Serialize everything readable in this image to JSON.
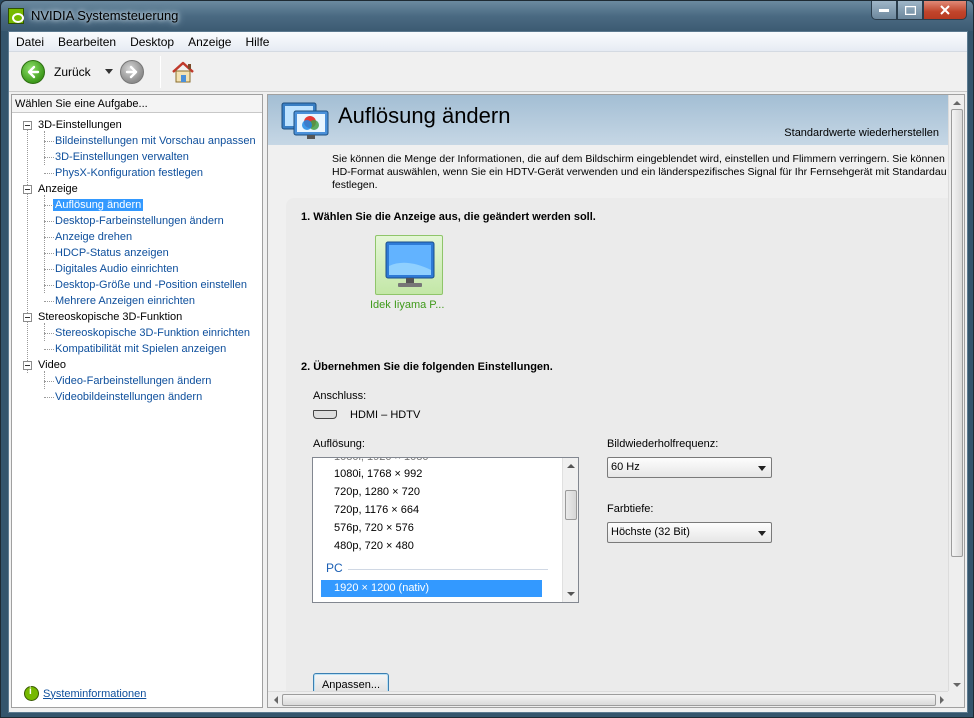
{
  "window": {
    "title": "NVIDIA Systemsteuerung"
  },
  "menu": [
    "Datei",
    "Bearbeiten",
    "Desktop",
    "Anzeige",
    "Hilfe"
  ],
  "toolbar": {
    "back_label": "Zurück"
  },
  "sidebar": {
    "header": "Wählen Sie eine Aufgabe...",
    "categories": [
      {
        "label": "3D-Einstellungen",
        "items": [
          "Bildeinstellungen mit Vorschau anpassen",
          "3D-Einstellungen verwalten",
          "PhysX-Konfiguration festlegen"
        ]
      },
      {
        "label": "Anzeige",
        "items": [
          "Auflösung ändern",
          "Desktop-Farbeinstellungen ändern",
          "Anzeige drehen",
          "HDCP-Status anzeigen",
          "Digitales Audio einrichten",
          "Desktop-Größe und -Position einstellen",
          "Mehrere Anzeigen einrichten"
        ]
      },
      {
        "label": "Stereoskopische 3D-Funktion",
        "items": [
          "Stereoskopische 3D-Funktion einrichten",
          "Kompatibilität mit Spielen anzeigen"
        ]
      },
      {
        "label": "Video",
        "items": [
          "Video-Farbeinstellungen ändern",
          "Videobildeinstellungen ändern"
        ]
      }
    ],
    "selected": "Auflösung ändern",
    "sysinfo": "Systeminformationen"
  },
  "page": {
    "title": "Auflösung ändern",
    "restore": "Standardwerte wiederherstellen",
    "description": "Sie können die Menge der Informationen, die auf dem Bildschirm eingeblendet wird, einstellen und Flimmern verringern. Sie können HD-Format auswählen, wenn Sie ein HDTV-Gerät verwenden und ein länderspezifisches Signal für Ihr Fernsehgerät mit Standardau festlegen.",
    "step1": "1. Wählen Sie die Anzeige aus, die geändert werden soll.",
    "display_name": "Idek Iiyama P...",
    "step2": "2. Übernehmen Sie die folgenden Einstellungen.",
    "connection_label": "Anschluss:",
    "connection_value": "HDMI – HDTV",
    "resolution_label": "Auflösung:",
    "resolutions": [
      "1080i, 1768 × 992",
      "720p, 1280 × 720",
      "720p, 1176 × 664",
      "576p, 720 × 576",
      "480p, 720 × 480"
    ],
    "resolution_group": "PC",
    "resolution_selected": "1920 × 1200 (nativ)",
    "refresh_label": "Bildwiederholfrequenz:",
    "refresh_value": "60 Hz",
    "depth_label": "Farbtiefe:",
    "depth_value": "Höchste (32 Bit)",
    "customize_button": "Anpassen..."
  },
  "colors": {
    "nvidia_green": "#76b900",
    "link_blue": "#0e4f9c",
    "selection": "#3399ff",
    "banner": "#b7cde0"
  }
}
